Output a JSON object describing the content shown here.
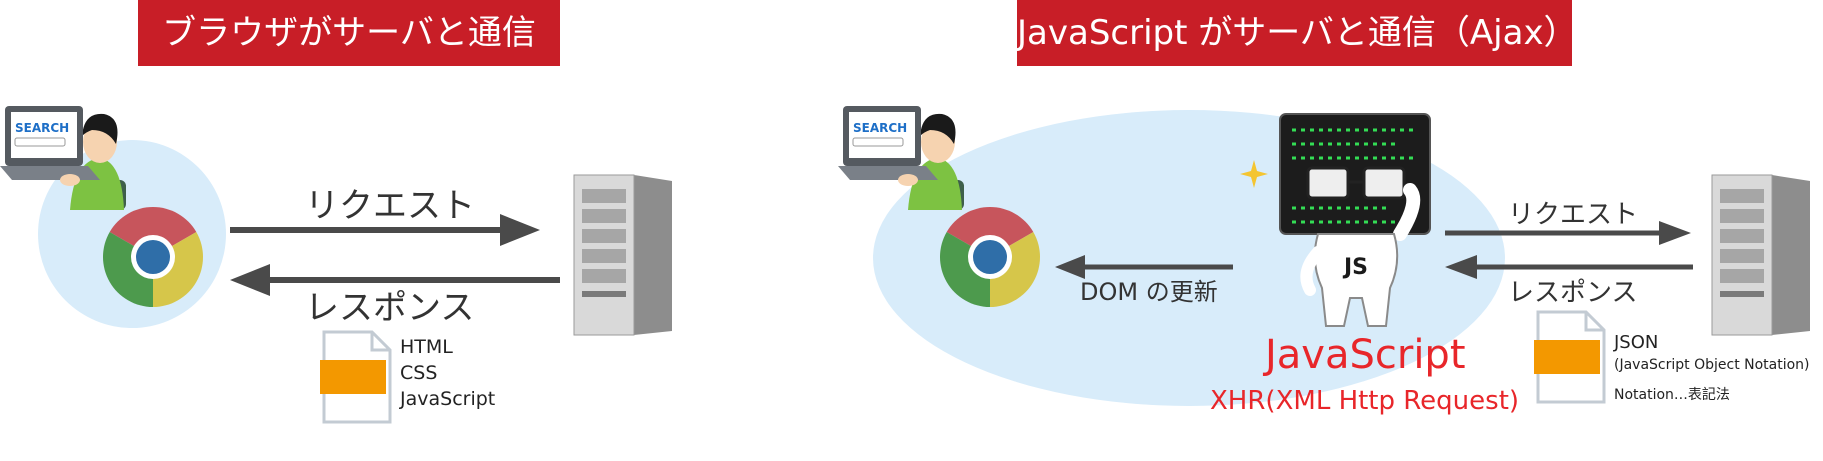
{
  "left": {
    "title": "ブラウザがサーバと通信",
    "request_label": "リクエスト",
    "response_label": "レスポンス",
    "search_text": "SEARCH",
    "documents": [
      "HTML",
      "CSS",
      "JavaScript"
    ]
  },
  "right": {
    "title": "JavaScript がサーバと通信（Ajax）",
    "request_label": "リクエスト",
    "response_label": "レスポンス",
    "search_text": "SEARCH",
    "dom_label": "DOM の更新",
    "js_badge": "JS",
    "js_title": "JavaScript",
    "js_subtitle": "XHR(XML Http Request)",
    "json_title": "JSON",
    "json_expansion": "(JavaScript Object Notation)",
    "json_note": "Notation…表記法"
  },
  "colors": {
    "banner": "#c81e27",
    "accent_red": "#e8262a",
    "bubble": "#d8ecfa",
    "arrow": "#4a4a4a",
    "doc_fill": "#f39800",
    "terminal_green": "#33dd55"
  }
}
